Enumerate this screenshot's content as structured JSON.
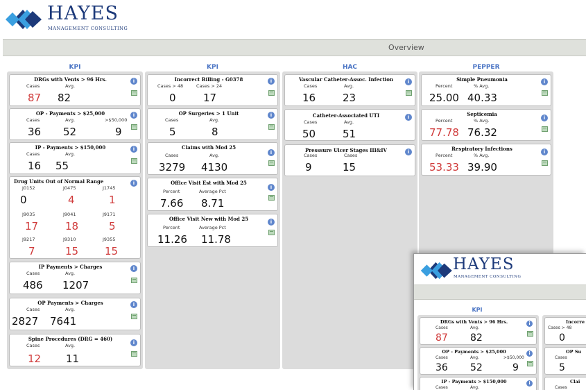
{
  "brand": {
    "title": "HAYES",
    "subtitle": "MANAGEMENT CONSULTING"
  },
  "nav": {
    "title": "Overview"
  },
  "icons": {
    "info": "info-icon",
    "grid": "spreadsheet-icon",
    "logo": "diamond-logo-icon"
  },
  "colors": {
    "accent": "#4a74c4",
    "alert": "#d03a3a",
    "column_bg": "#dcdcdc",
    "nav_bg": "#dfe1dc"
  },
  "columns": [
    {
      "header": "KPI",
      "cards": [
        {
          "title": "DRGs with Vents > 96 Hrs.",
          "labels": [
            "Cases",
            "Avg."
          ],
          "values": [
            "87",
            "82"
          ]
        },
        {
          "title": "OP - Payments > $25,000",
          "labels": [
            "Cases",
            "Avg.",
            ">$50,000"
          ],
          "values": [
            "36",
            "52",
            "9"
          ]
        },
        {
          "title": "IP - Payments > $150,000",
          "labels": [
            "Cases",
            "Avg."
          ],
          "values": [
            "16",
            "55"
          ]
        },
        {
          "title": "Drug Units Out of Normal Range",
          "rows": [
            {
              "labels": [
                "J0152",
                "J0475",
                "J1745"
              ],
              "values": [
                "0",
                "4",
                "1"
              ]
            },
            {
              "labels": [
                "J9035",
                "J9041",
                "J9171"
              ],
              "values": [
                "17",
                "18",
                "5"
              ]
            },
            {
              "labels": [
                "J9217",
                "J9310",
                "J9355"
              ],
              "values": [
                "7",
                "15",
                "15"
              ]
            }
          ]
        },
        {
          "title": "IP Payments > Charges",
          "labels": [
            "Cases",
            "Avg."
          ],
          "values": [
            "486",
            "1207"
          ]
        },
        {
          "title": "OP Payments > Charges",
          "labels": [
            "Cases",
            "Avg."
          ],
          "values": [
            "2827",
            "7641"
          ]
        },
        {
          "title": "Spine Procedures (DRG = 460)",
          "labels": [
            "Cases",
            "Avg."
          ],
          "values": [
            "12",
            "11"
          ]
        }
      ]
    },
    {
      "header": "KPI",
      "cards": [
        {
          "title": "Incorrect Billing - G0378",
          "labels": [
            "Cases > 48",
            "Cases > 24"
          ],
          "values": [
            "0",
            "17"
          ]
        },
        {
          "title": "OP Surgeries > 1 Unit",
          "labels": [
            "Cases",
            "Avg."
          ],
          "values": [
            "5",
            "8"
          ]
        },
        {
          "title": "Claims with Mod 25",
          "labels": [
            "Cases",
            "Avg."
          ],
          "values": [
            "3279",
            "4130"
          ]
        },
        {
          "title": "Office Visit Est with Mod 25",
          "labels": [
            "Percent",
            "Average Pct"
          ],
          "values": [
            "7.66",
            "8.71"
          ]
        },
        {
          "title": "Office Visit New with Mod 25",
          "labels": [
            "Percent",
            "Average Pct"
          ],
          "values": [
            "11.26",
            "11.78"
          ]
        }
      ]
    },
    {
      "header": "HAC",
      "cards": [
        {
          "title": "Vascular Catheter-Assoc. Infection",
          "labels": [
            "Cases",
            "Avg."
          ],
          "values": [
            "16",
            "23"
          ]
        },
        {
          "title": "Catheter-Associated UTI",
          "labels": [
            "Cases",
            "Avg."
          ],
          "values": [
            "50",
            "51"
          ]
        },
        {
          "title": "Presssure Ulcer Stages III&IV",
          "labels": [
            "Cases",
            "Cases"
          ],
          "values": [
            "9",
            "15"
          ]
        }
      ]
    },
    {
      "header": "PEPPER",
      "cards": [
        {
          "title": "Simple Pneumonia",
          "labels": [
            "Percent",
            "% Avg."
          ],
          "values": [
            "25.00",
            "40.33"
          ]
        },
        {
          "title": "Septicemia",
          "labels": [
            "Percent",
            "% Avg."
          ],
          "values": [
            "77.78",
            "76.32"
          ]
        },
        {
          "title": "Respiratory Infections",
          "labels": [
            "Percent",
            "% Avg."
          ],
          "values": [
            "53.33",
            "39.90"
          ]
        }
      ]
    }
  ],
  "overlay": {
    "brand": {
      "title": "HAYES",
      "subtitle": "MANAGEMENT CONSULTING"
    },
    "col1_header": "KPI",
    "cards": [
      {
        "title": "DRGs with Vents > 96 Hrs.",
        "labels": [
          "Cases",
          "Avg."
        ],
        "values": [
          "87",
          "82"
        ]
      },
      {
        "title": "OP - Payments > $25,000",
        "labels": [
          "Cases",
          "Avg.",
          ">$50,000"
        ],
        "values": [
          "36",
          "52",
          "9"
        ]
      },
      {
        "title": "IP - Payments > $150,000",
        "labels": [
          "Cases",
          "Avg."
        ],
        "values": [
          "",
          ""
        ]
      }
    ],
    "col2_cards": [
      {
        "title": "Incorre",
        "labels": [
          "Cases > 48"
        ],
        "values": [
          "0"
        ]
      },
      {
        "title": "OP Su",
        "labels": [
          "Cases"
        ],
        "values": [
          "5"
        ]
      },
      {
        "title": "Clai",
        "labels": [
          "Cases"
        ],
        "values": [
          ""
        ]
      }
    ]
  }
}
